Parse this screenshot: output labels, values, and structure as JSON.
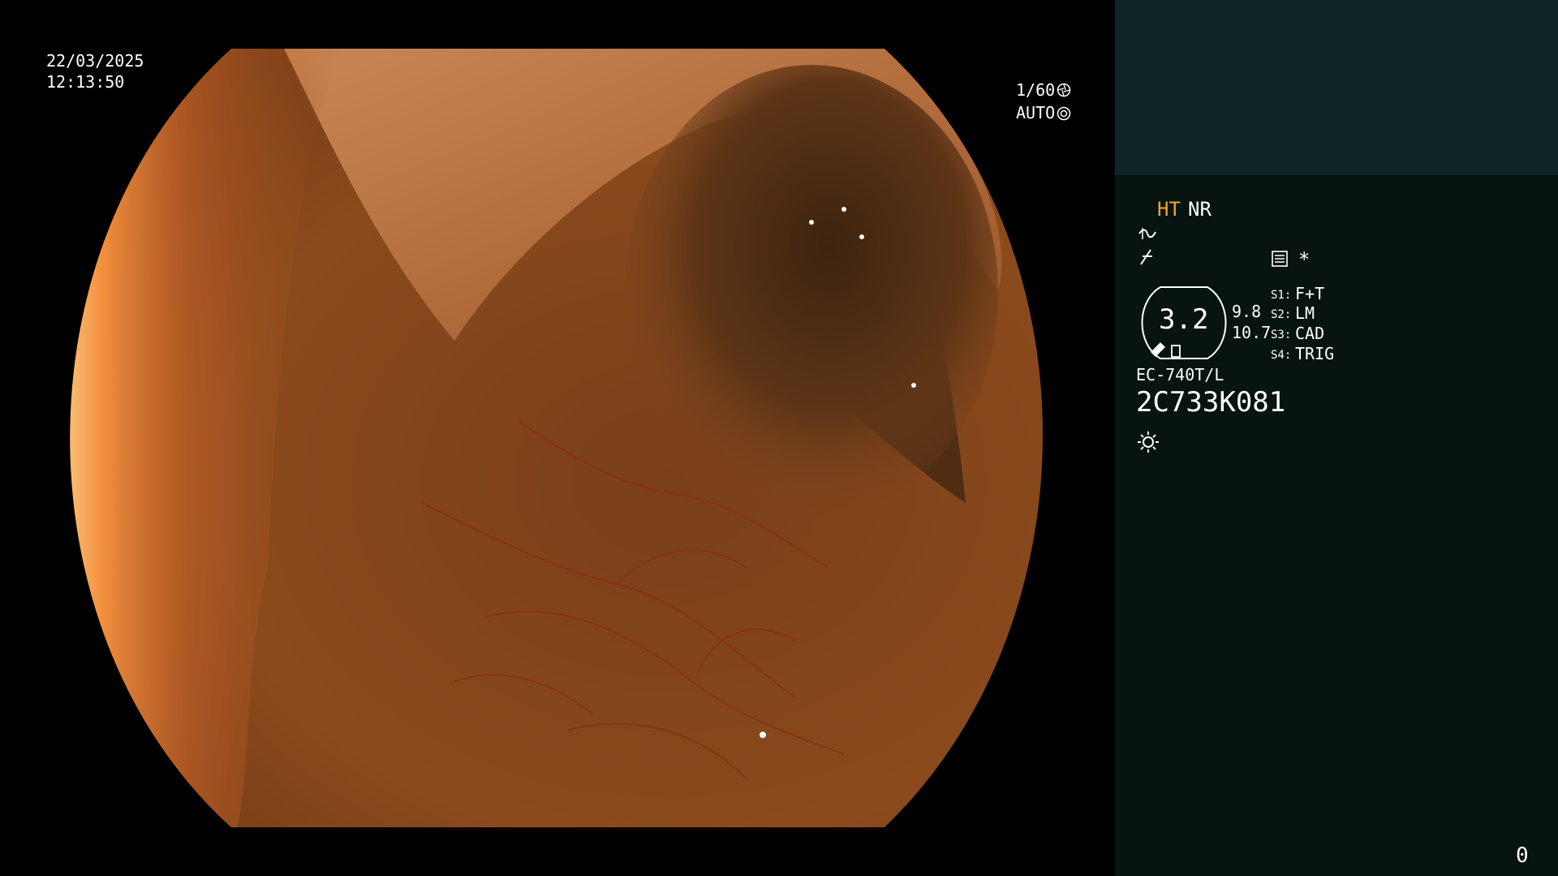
{
  "colors": {
    "panel_top": "#0f2628",
    "panel_bottom": "#071412",
    "highlight": "#f2a623",
    "text": "#ffffff"
  },
  "osd": {
    "date": "22/03/2025",
    "time": "12:13:50",
    "shutter": "1/60",
    "iris": "AUTO",
    "shutter_icon": "aperture-icon",
    "iris_icon": "ring-icon"
  },
  "panel": {
    "mode_ht": "HT",
    "mode_nr": "NR",
    "structure_icon": "structure-enhance-icon",
    "color_icon": "color-tone-icon",
    "memory_icon": "memory-icon",
    "asterisk": "*",
    "zoom": {
      "value": "3.2",
      "upper": "9.8",
      "lower": "10.7"
    },
    "switches": [
      {
        "key": "S1:",
        "value": "F+T"
      },
      {
        "key": "S2:",
        "value": "LM"
      },
      {
        "key": "S3:",
        "value": "CAD"
      },
      {
        "key": "S4:",
        "value": "TRIG"
      }
    ],
    "scope_model": "EC-740T/L",
    "serial": "2C733K081",
    "light_icon": "light-icon",
    "counter": "0"
  }
}
